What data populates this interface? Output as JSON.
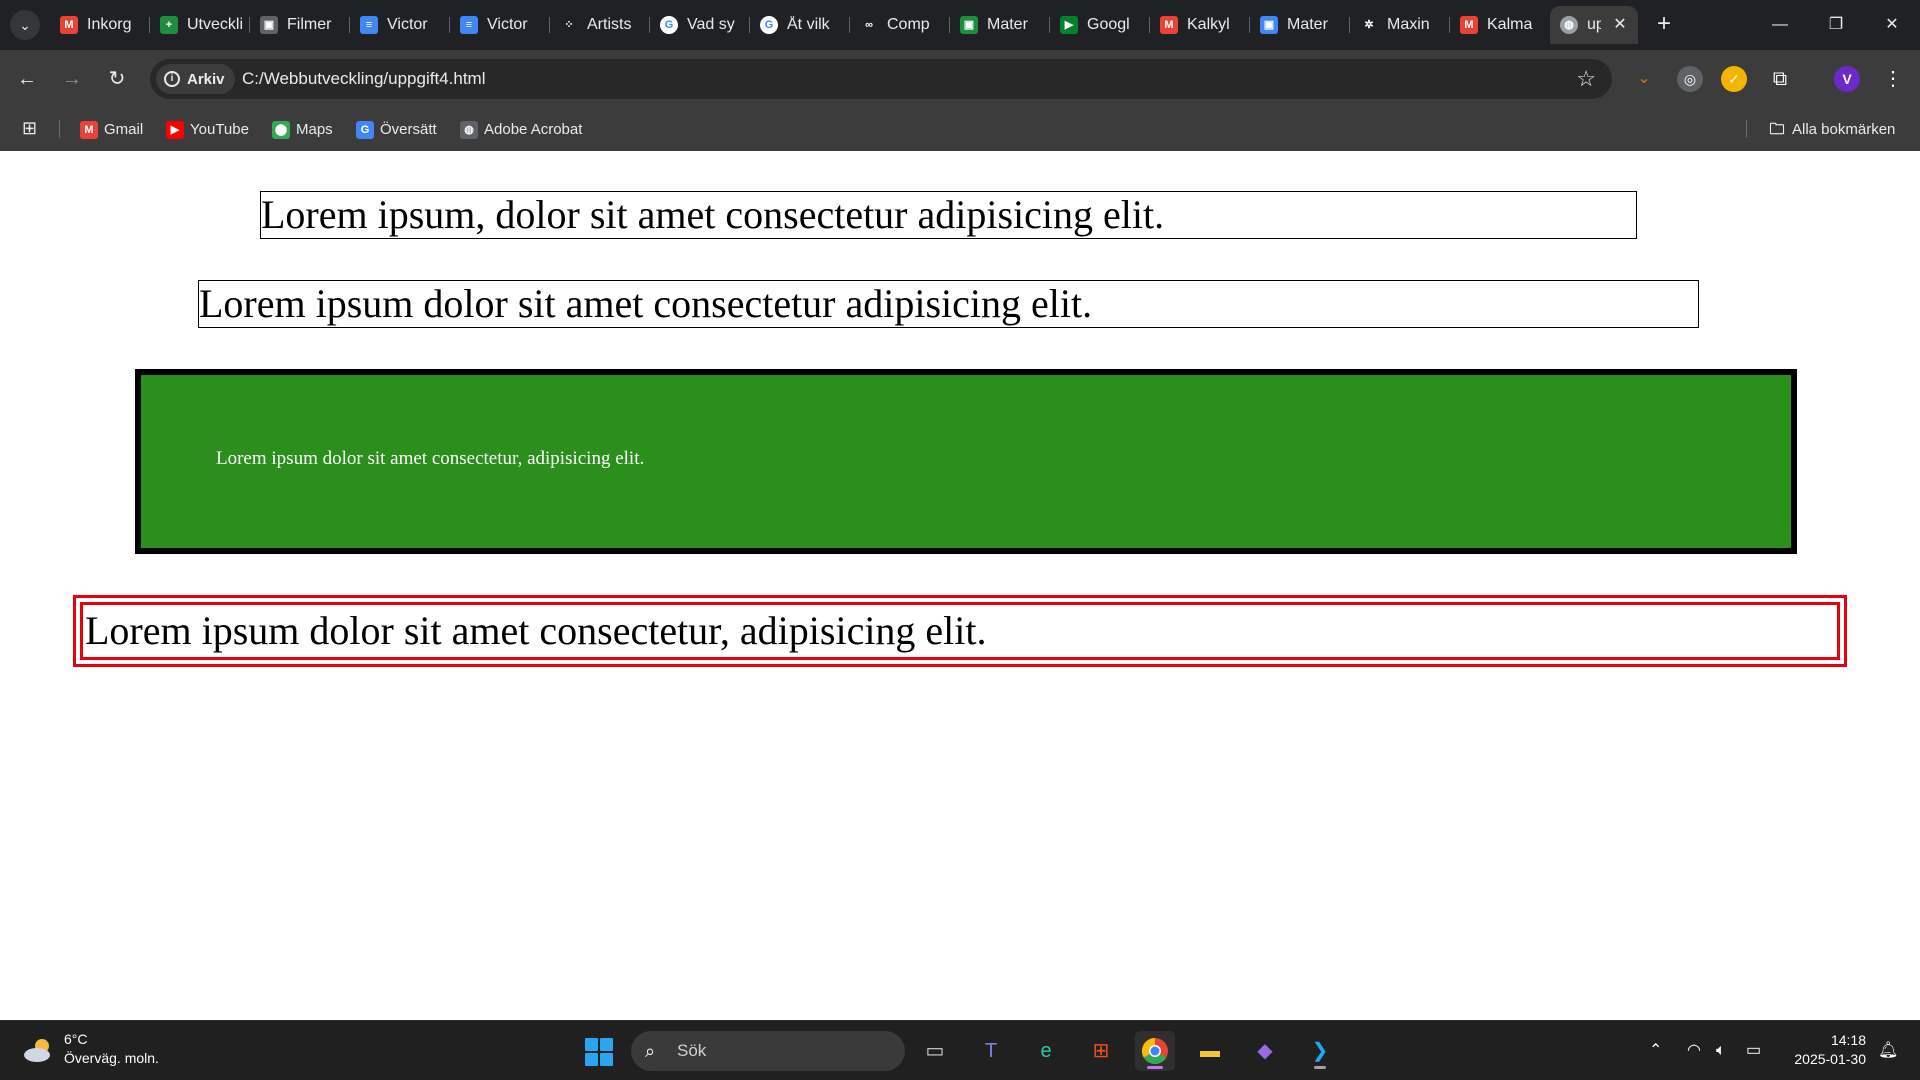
{
  "browser": {
    "tabs": [
      {
        "label": "Inkorg",
        "icon": "gmail-icon",
        "color": "#ea4335",
        "glyph": "M"
      },
      {
        "label": "Utveckling",
        "icon": "sheets-icon",
        "color": "#1e8e3e",
        "glyph": "+"
      },
      {
        "label": "Filmer",
        "icon": "classroom-icon",
        "color": "#5f6368",
        "glyph": "▣"
      },
      {
        "label": "Victor",
        "icon": "docs-icon",
        "color": "#4285f4",
        "glyph": "≡"
      },
      {
        "label": "Victor",
        "icon": "docs-icon",
        "color": "#4285f4",
        "glyph": "≡"
      },
      {
        "label": "Artists",
        "icon": "artists-icon",
        "color": "#202124",
        "glyph": "⁘"
      },
      {
        "label": "Vad sy",
        "icon": "google-icon",
        "color": "#ffffff",
        "glyph": "G"
      },
      {
        "label": "Åt vilk",
        "icon": "google-icon",
        "color": "#ffffff",
        "glyph": "G"
      },
      {
        "label": "Comp",
        "icon": "copilot-icon",
        "color": "#202124",
        "glyph": "∞"
      },
      {
        "label": "Mater",
        "icon": "classroom-icon",
        "color": "#1e8e3e",
        "glyph": "▣"
      },
      {
        "label": "Googl",
        "icon": "meet-icon",
        "color": "#00832d",
        "glyph": "▶"
      },
      {
        "label": "Kalkyl",
        "icon": "gmail-icon",
        "color": "#ea4335",
        "glyph": "M"
      },
      {
        "label": "Mater",
        "icon": "classroom-icon",
        "color": "#4285f4",
        "glyph": "▣"
      },
      {
        "label": "Maxin",
        "icon": "chatgpt-icon",
        "color": "#202124",
        "glyph": "✲"
      },
      {
        "label": "Kalma",
        "icon": "gmail-icon",
        "color": "#ea4335",
        "glyph": "M"
      },
      {
        "label": "up",
        "icon": "globe-icon",
        "color": "#9aa0a6",
        "glyph": "◍",
        "active": true
      }
    ],
    "close_tab": "✕",
    "new_tab": "+",
    "window": {
      "minimize": "—",
      "restore": "❐",
      "close": "✕"
    },
    "address": {
      "chip_label": "Arkiv",
      "url": "C:/Webbutveckling/uppgift4.html"
    },
    "bookmarks": [
      {
        "label": "Gmail",
        "icon": "gmail-icon",
        "color": "#ea4335",
        "glyph": "M"
      },
      {
        "label": "YouTube",
        "icon": "youtube-icon",
        "color": "#ff0000",
        "glyph": "▶"
      },
      {
        "label": "Maps",
        "icon": "maps-icon",
        "color": "#34a853",
        "glyph": "⬤"
      },
      {
        "label": "Översätt",
        "icon": "translate-icon",
        "color": "#4285f4",
        "glyph": "G"
      },
      {
        "label": "Adobe Acrobat",
        "icon": "globe-icon",
        "color": "#5f6368",
        "glyph": "◍"
      }
    ],
    "all_bookmarks": "Alla bokmärken",
    "profile_initial": "V"
  },
  "page": {
    "p1": "Lorem ipsum, dolor sit amet consectetur adipisicing elit.",
    "p2": "Lorem ipsum dolor sit amet consectetur adipisicing elit.",
    "p3": "Lorem ipsum dolor sit amet consectetur, adipisicing elit.",
    "p4": "Lorem ipsum dolor sit amet consectetur, adipisicing elit.",
    "colors": {
      "green_box": "#2a901b",
      "red_border": "#e8000b"
    }
  },
  "taskbar": {
    "weather": {
      "temp": "6°C",
      "desc": "Överväg. moln."
    },
    "search_placeholder": "Sök",
    "clock": {
      "time": "14:18",
      "date": "2025-01-30"
    }
  }
}
